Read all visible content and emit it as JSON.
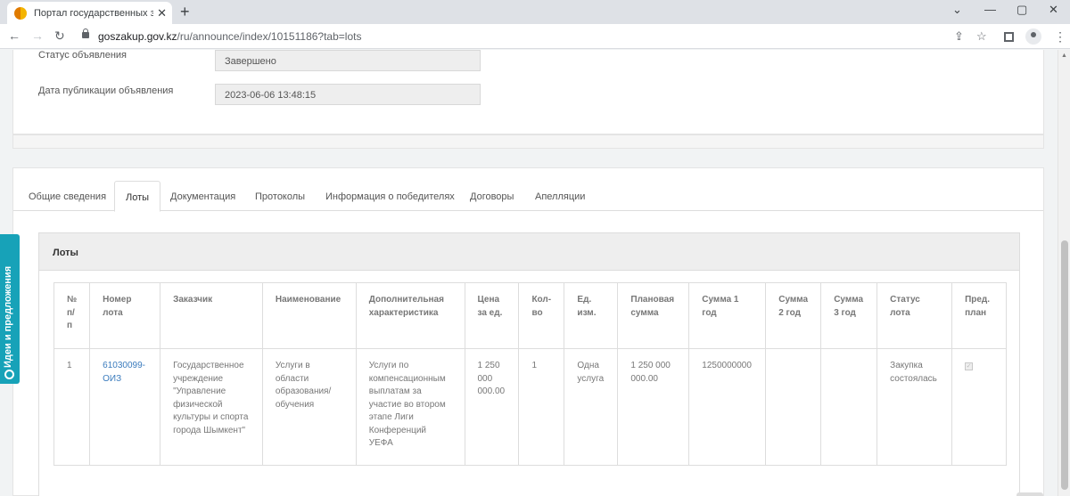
{
  "browser": {
    "tab_title": "Портал государственных закупок",
    "tab_close": "✕",
    "new_tab": "+",
    "tab_search": "⌄",
    "minimize": "—",
    "maximize": "▢",
    "close_window": "✕",
    "back": "←",
    "forward": "→",
    "reload": "↻",
    "url_host": "goszakup.gov.kz",
    "url_path": "/ru/announce/index/10151186?tab=lots",
    "share": "⇪",
    "star": "☆",
    "menu": "⋮"
  },
  "announcement": {
    "status_label": "Статус объявления",
    "status_value": "Завершено",
    "pubdate_label": "Дата публикации объявления",
    "pubdate_value": "2023-06-06 13:48:15"
  },
  "tabs": [
    "Общие сведения",
    "Лоты",
    "Документация",
    "Протоколы",
    "Информация о победителях",
    "Договоры",
    "Апелляции"
  ],
  "lots": {
    "title": "Лоты",
    "columns": [
      "№ п/п",
      "Номер лота",
      "Заказчик",
      "Наименование",
      "Дополнительная характеристика",
      "Цена за ед.",
      "Кол-во",
      "Ед. изм.",
      "Плановая сумма",
      "Сумма 1 год",
      "Сумма 2 год",
      "Сумма 3 год",
      "Статус лота",
      "Пред. план"
    ],
    "row": {
      "num": "1",
      "lot_number": "61030099-ОИЗ",
      "customer": "Государственное учреждение \"Управление физической культуры и спорта города Шымкент\"",
      "name": "Услуги в области образования/ обучения",
      "extra": "Услуги по компенсационным выплатам за участие во втором этапе Лиги Конференций УЕФА",
      "price": "1 250 000 000.00",
      "qty": "1",
      "unit": "Одна услуга",
      "planned": "1 250 000 000.00",
      "sum1": "1250000000",
      "sum2": "",
      "sum3": "",
      "status": "Закупка состоялась",
      "preplan_check": "✓"
    }
  },
  "side_widget": "Идеи и предложения",
  "scroll_up": "▲"
}
